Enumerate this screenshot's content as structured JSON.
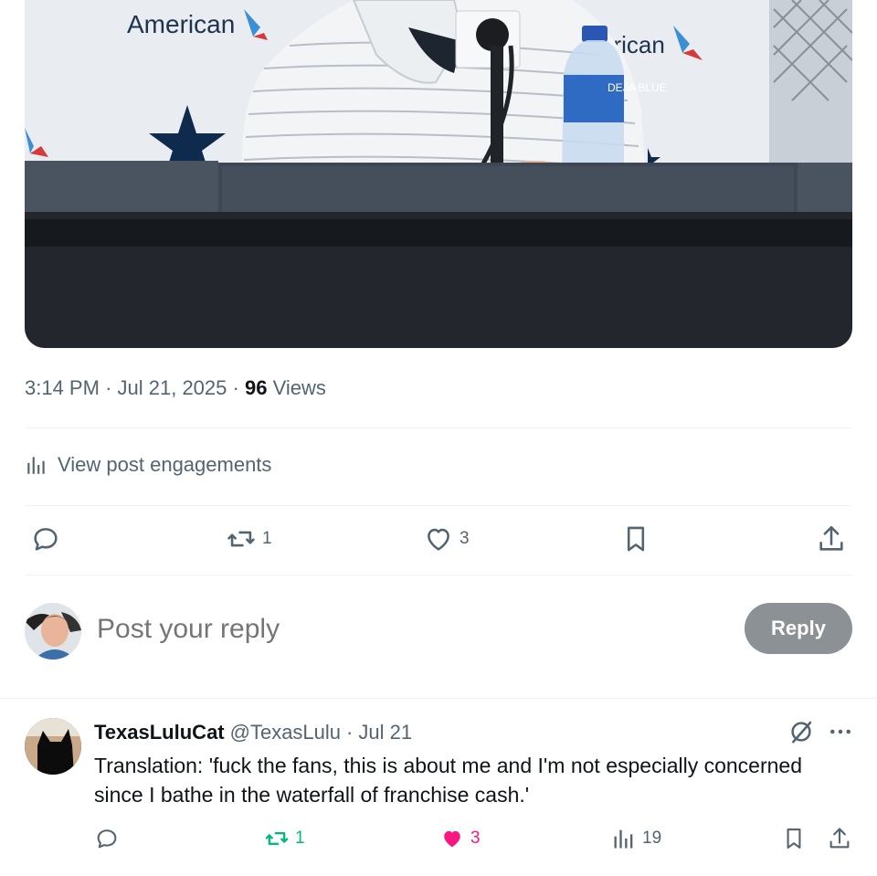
{
  "post": {
    "photo": {
      "banner_text_left": "American",
      "banner_text_right": "erican",
      "bottle_label": "DEJA BLUE"
    },
    "time": "3:14 PM",
    "sep1": "·",
    "date": "Jul 21, 2025",
    "sep2": "·",
    "views_count": "96",
    "views_label": "Views",
    "engagements_label": "View post engagements",
    "actions": {
      "reply_count": "",
      "retweet_count": "1",
      "like_count": "3"
    }
  },
  "composer": {
    "placeholder": "Post your reply",
    "button_label": "Reply"
  },
  "reply_tweet": {
    "display_name": "TexasLuluCat",
    "handle": "@TexasLulu",
    "separator": "·",
    "date": "Jul 21",
    "text": "Translation:  'fuck the fans, this is about me and I'm not especially concerned since I bathe in the waterfall of franchise cash.'",
    "retweet_count": "1",
    "like_count": "3",
    "views_count": "19",
    "colors": {
      "retweet_active": "#00ba7c",
      "like_active": "#f91880"
    }
  },
  "icons": {
    "engagements": "bar-chart-icon",
    "reply": "speech-bubble-icon",
    "retweet": "retweet-arrows-icon",
    "like": "heart-icon",
    "bookmark": "bookmark-icon",
    "share": "share-upload-icon",
    "grok": "grok-slash-icon",
    "more": "more-dots-icon"
  }
}
